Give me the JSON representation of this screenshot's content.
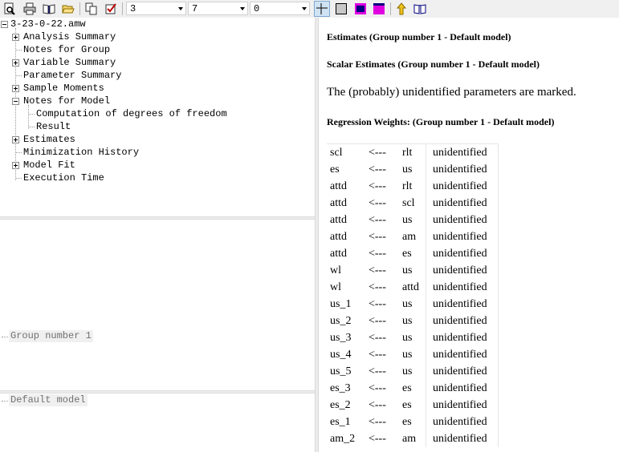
{
  "toolbar": {
    "select1": "3",
    "select2": "7",
    "select3": "0",
    "icons": [
      "print-preview-icon",
      "print-icon",
      "book-icon",
      "open-folder-icon",
      "copy-icon",
      "checkbox-icon",
      "table-grid-icon",
      "gray-square-icon",
      "magenta-frame-icon",
      "magenta-square-icon",
      "up-arrow-icon",
      "open-book-icon"
    ],
    "accent_colors": {
      "magenta": "#e000e0",
      "navy": "#000080"
    }
  },
  "tree": {
    "root": "3-23-0-22.amw",
    "items": [
      {
        "label": "Analysis Summary",
        "expander": "plus"
      },
      {
        "label": "Notes for Group",
        "expander": "none"
      },
      {
        "label": "Variable Summary",
        "expander": "plus"
      },
      {
        "label": "Parameter Summary",
        "expander": "none"
      },
      {
        "label": "Sample Moments",
        "expander": "plus"
      },
      {
        "label": "Notes for Model",
        "expander": "minus"
      },
      {
        "label": "Computation of degrees of freedom",
        "expander": "child"
      },
      {
        "label": "Result",
        "expander": "child"
      },
      {
        "label": "Estimates",
        "expander": "plus"
      },
      {
        "label": "Minimization History",
        "expander": "none"
      },
      {
        "label": "Model Fit",
        "expander": "plus"
      },
      {
        "label": "Execution Time",
        "expander": "none"
      }
    ]
  },
  "groups": {
    "item": "Group number 1"
  },
  "models": {
    "item": "Default model"
  },
  "output": {
    "heading1": "Estimates (Group number 1 - Default model)",
    "heading2": "Scalar Estimates (Group number 1 - Default model)",
    "note": "The (probably) unidentified parameters are marked.",
    "heading3": "Regression Weights: (Group number 1 - Default model)",
    "rows": [
      [
        "scl",
        "<---",
        "rlt",
        "unidentified"
      ],
      [
        "es",
        "<---",
        "us",
        "unidentified"
      ],
      [
        "attd",
        "<---",
        "rlt",
        "unidentified"
      ],
      [
        "attd",
        "<---",
        "scl",
        "unidentified"
      ],
      [
        "attd",
        "<---",
        "us",
        "unidentified"
      ],
      [
        "attd",
        "<---",
        "am",
        "unidentified"
      ],
      [
        "attd",
        "<---",
        "es",
        "unidentified"
      ],
      [
        "wl",
        "<---",
        "us",
        "unidentified"
      ],
      [
        "wl",
        "<---",
        "attd",
        "unidentified"
      ],
      [
        "us_1",
        "<---",
        "us",
        "unidentified"
      ],
      [
        "us_2",
        "<---",
        "us",
        "unidentified"
      ],
      [
        "us_3",
        "<---",
        "us",
        "unidentified"
      ],
      [
        "us_4",
        "<---",
        "us",
        "unidentified"
      ],
      [
        "us_5",
        "<---",
        "us",
        "unidentified"
      ],
      [
        "es_3",
        "<---",
        "es",
        "unidentified"
      ],
      [
        "es_2",
        "<---",
        "es",
        "unidentified"
      ],
      [
        "es_1",
        "<---",
        "es",
        "unidentified"
      ],
      [
        "am_2",
        "<---",
        "am",
        "unidentified"
      ]
    ]
  }
}
